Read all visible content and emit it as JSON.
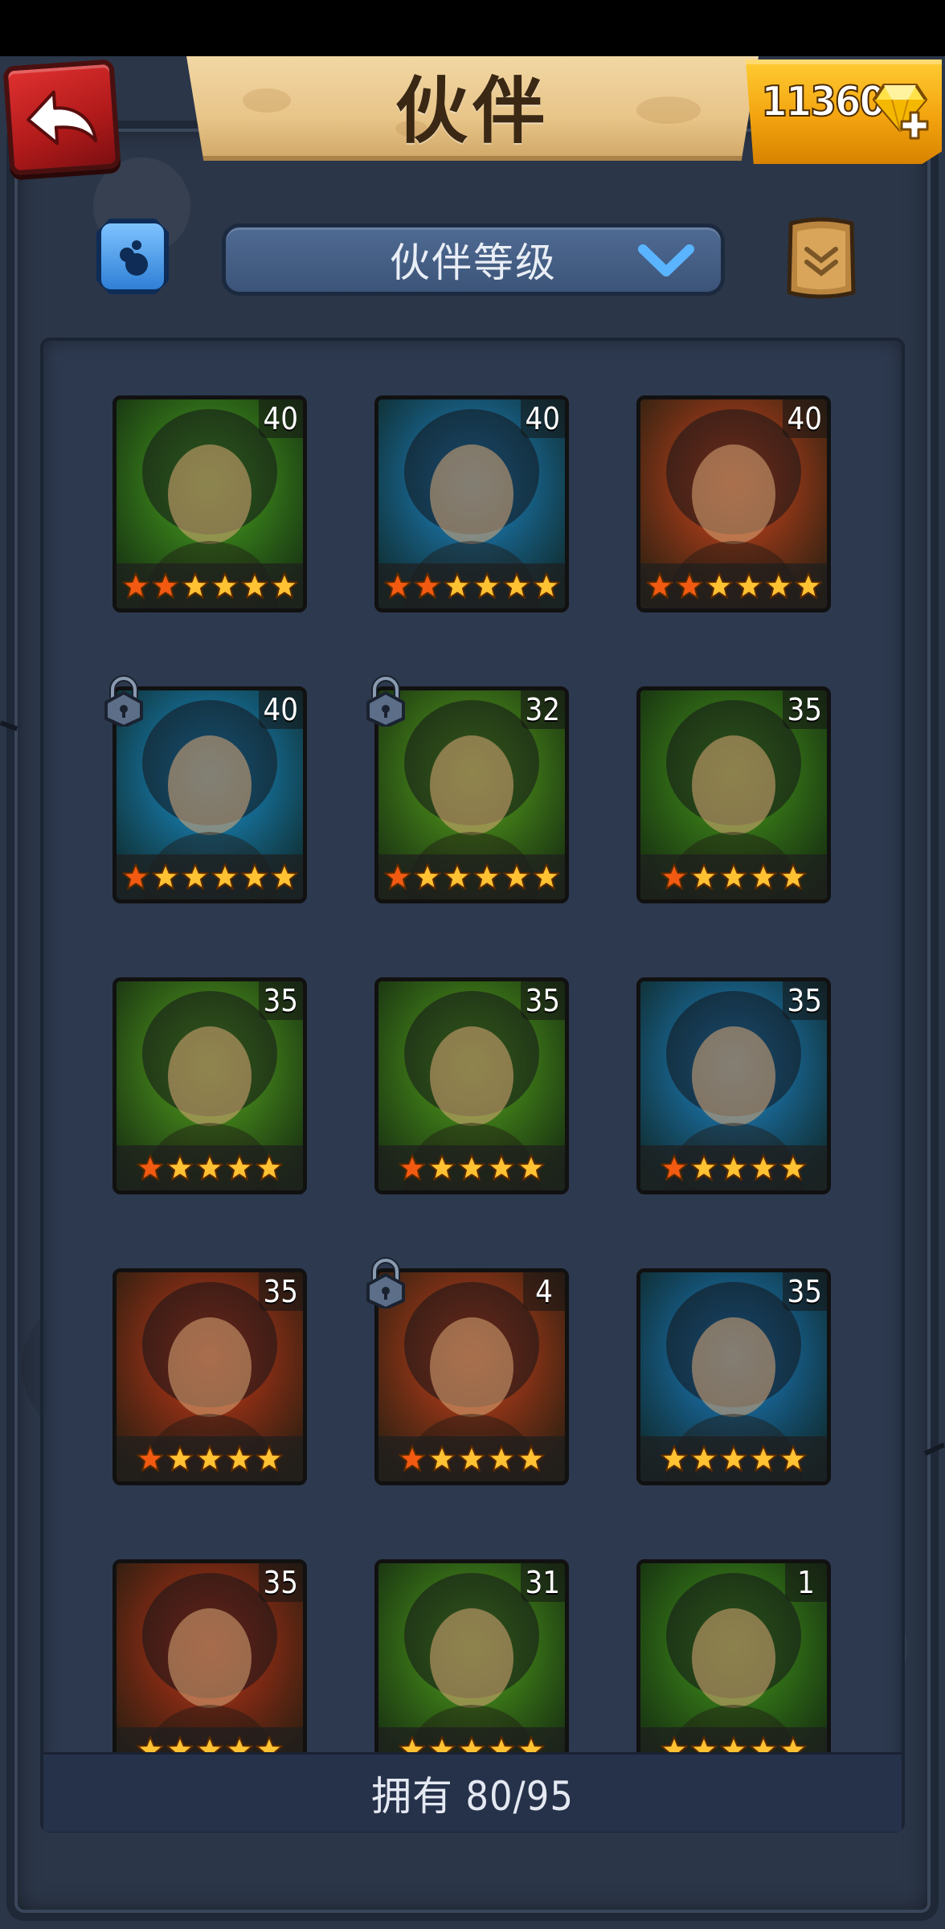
{
  "header": {
    "title": "伙伴",
    "gems": "11360"
  },
  "toolbar": {
    "sort_label": "伙伴等级"
  },
  "footer": {
    "owned_label": "拥有 80/95"
  },
  "cards": [
    {
      "level": "40",
      "stars_filled": 2,
      "stars_total": 6,
      "locked": false,
      "bg": "#4caf1f"
    },
    {
      "level": "40",
      "stars_filled": 2,
      "stars_total": 6,
      "locked": false,
      "bg": "#1e8fd6"
    },
    {
      "level": "40",
      "stars_filled": 2,
      "stars_total": 6,
      "locked": false,
      "bg": "#e0481c"
    },
    {
      "level": "40",
      "stars_filled": 1,
      "stars_total": 6,
      "locked": true,
      "bg": "#1a9be0"
    },
    {
      "level": "32",
      "stars_filled": 1,
      "stars_total": 6,
      "locked": true,
      "bg": "#5cae1c"
    },
    {
      "level": "35",
      "stars_filled": 1,
      "stars_total": 5,
      "locked": false,
      "bg": "#4aa21a"
    },
    {
      "level": "35",
      "stars_filled": 1,
      "stars_total": 5,
      "locked": false,
      "bg": "#5ab01e"
    },
    {
      "level": "35",
      "stars_filled": 1,
      "stars_total": 5,
      "locked": false,
      "bg": "#58ad1c"
    },
    {
      "level": "35",
      "stars_filled": 1,
      "stars_total": 5,
      "locked": false,
      "bg": "#1f8ed8"
    },
    {
      "level": "35",
      "stars_filled": 1,
      "stars_total": 5,
      "locked": false,
      "bg": "#d63a17"
    },
    {
      "level": "4",
      "stars_filled": 1,
      "stars_total": 5,
      "locked": true,
      "bg": "#d8421a"
    },
    {
      "level": "35",
      "stars_filled": 0,
      "stars_total": 5,
      "locked": false,
      "bg": "#1c86d2"
    },
    {
      "level": "35",
      "stars_filled": 0,
      "stars_total": 5,
      "locked": false,
      "bg": "#cc3416"
    },
    {
      "level": "31",
      "stars_filled": 0,
      "stars_total": 5,
      "locked": false,
      "bg": "#54aa1c"
    },
    {
      "level": "1",
      "stars_filled": 0,
      "stars_total": 5,
      "locked": false,
      "bg": "#46a01a"
    }
  ],
  "colors": {
    "star_orange": "#f25a12",
    "star_gold": "#ffc233",
    "stone": "#2b3648"
  }
}
